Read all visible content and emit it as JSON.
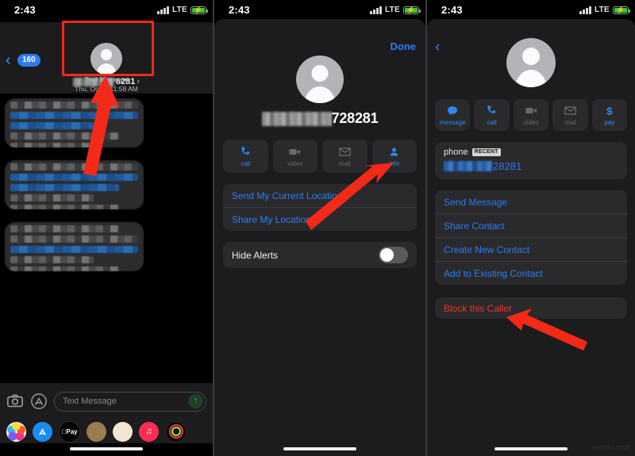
{
  "meta": {
    "watermark": "wsxdn.com"
  },
  "status_bar": {
    "time": "2:43",
    "carrier": "LTE",
    "signal_icon": "cellular-bars-icon",
    "battery_icon": "battery-charging-icon",
    "battery_color": "#37c93a"
  },
  "colors": {
    "accent_blue": "#2b7cf5",
    "danger_red": "#e8342a",
    "annotation_red": "#f42a19",
    "sheet_bg": "#1c1c1e",
    "card_bg": "#2a2a2c"
  },
  "panel1": {
    "name": "messages-conversation",
    "back_badge": "160",
    "back_icon": "chevron-left-icon",
    "contact": {
      "avatar_icon": "person-placeholder-icon",
      "name_redacted": true,
      "name_digits": "8281",
      "chevron": "›"
    },
    "message_meta": {
      "label": "Text Message",
      "timestamp": "Thu, Oct 8, 11:58 AM"
    },
    "compose": {
      "camera_icon": "camera-icon",
      "apps_icon": "app-store-icon",
      "placeholder": "Text Message",
      "send_icon": "send-arrow-up-icon"
    },
    "dock_apps": [
      {
        "name": "photos-app-icon",
        "label": ""
      },
      {
        "name": "app-store-app-icon",
        "label": ""
      },
      {
        "name": "apple-pay-app-icon",
        "label": "Pay"
      },
      {
        "name": "memoji-sticker-1-icon",
        "label": ""
      },
      {
        "name": "memoji-sticker-2-icon",
        "label": ""
      },
      {
        "name": "music-app-icon",
        "label": "♫"
      },
      {
        "name": "fitness-app-icon",
        "label": ""
      }
    ]
  },
  "panel2": {
    "name": "conversation-details-sheet",
    "done_label": "Done",
    "contact": {
      "avatar_icon": "person-placeholder-icon",
      "name_redacted": true,
      "name_digits": "728281"
    },
    "actions": [
      {
        "label": "call",
        "icon": "phone-icon",
        "enabled": true
      },
      {
        "label": "video",
        "icon": "video-camera-icon",
        "enabled": false
      },
      {
        "label": "mail",
        "icon": "envelope-icon",
        "enabled": false
      },
      {
        "label": "info",
        "icon": "person-circle-icon",
        "enabled": true
      }
    ],
    "location_rows": [
      "Send My Current Location",
      "Share My Location"
    ],
    "hide_alerts": {
      "label": "Hide Alerts",
      "value": "off"
    }
  },
  "panel3": {
    "name": "contact-card",
    "back_icon": "chevron-left-icon",
    "contact": {
      "avatar_icon": "person-placeholder-icon"
    },
    "actions": [
      {
        "label": "message",
        "icon": "message-bubble-icon",
        "enabled": true
      },
      {
        "label": "call",
        "icon": "phone-icon",
        "enabled": true
      },
      {
        "label": "video",
        "icon": "video-camera-icon",
        "enabled": false
      },
      {
        "label": "mail",
        "icon": "envelope-icon",
        "enabled": false
      },
      {
        "label": "pay",
        "icon": "dollar-sign-icon",
        "enabled": true
      }
    ],
    "phone": {
      "label": "phone",
      "badge": "RECENT",
      "number_redacted": true,
      "number_digits": "28281"
    },
    "menu_rows": [
      "Send Message",
      "Share Contact",
      "Create New Contact",
      "Add to Existing Contact"
    ],
    "block_row": "Block this Caller"
  }
}
